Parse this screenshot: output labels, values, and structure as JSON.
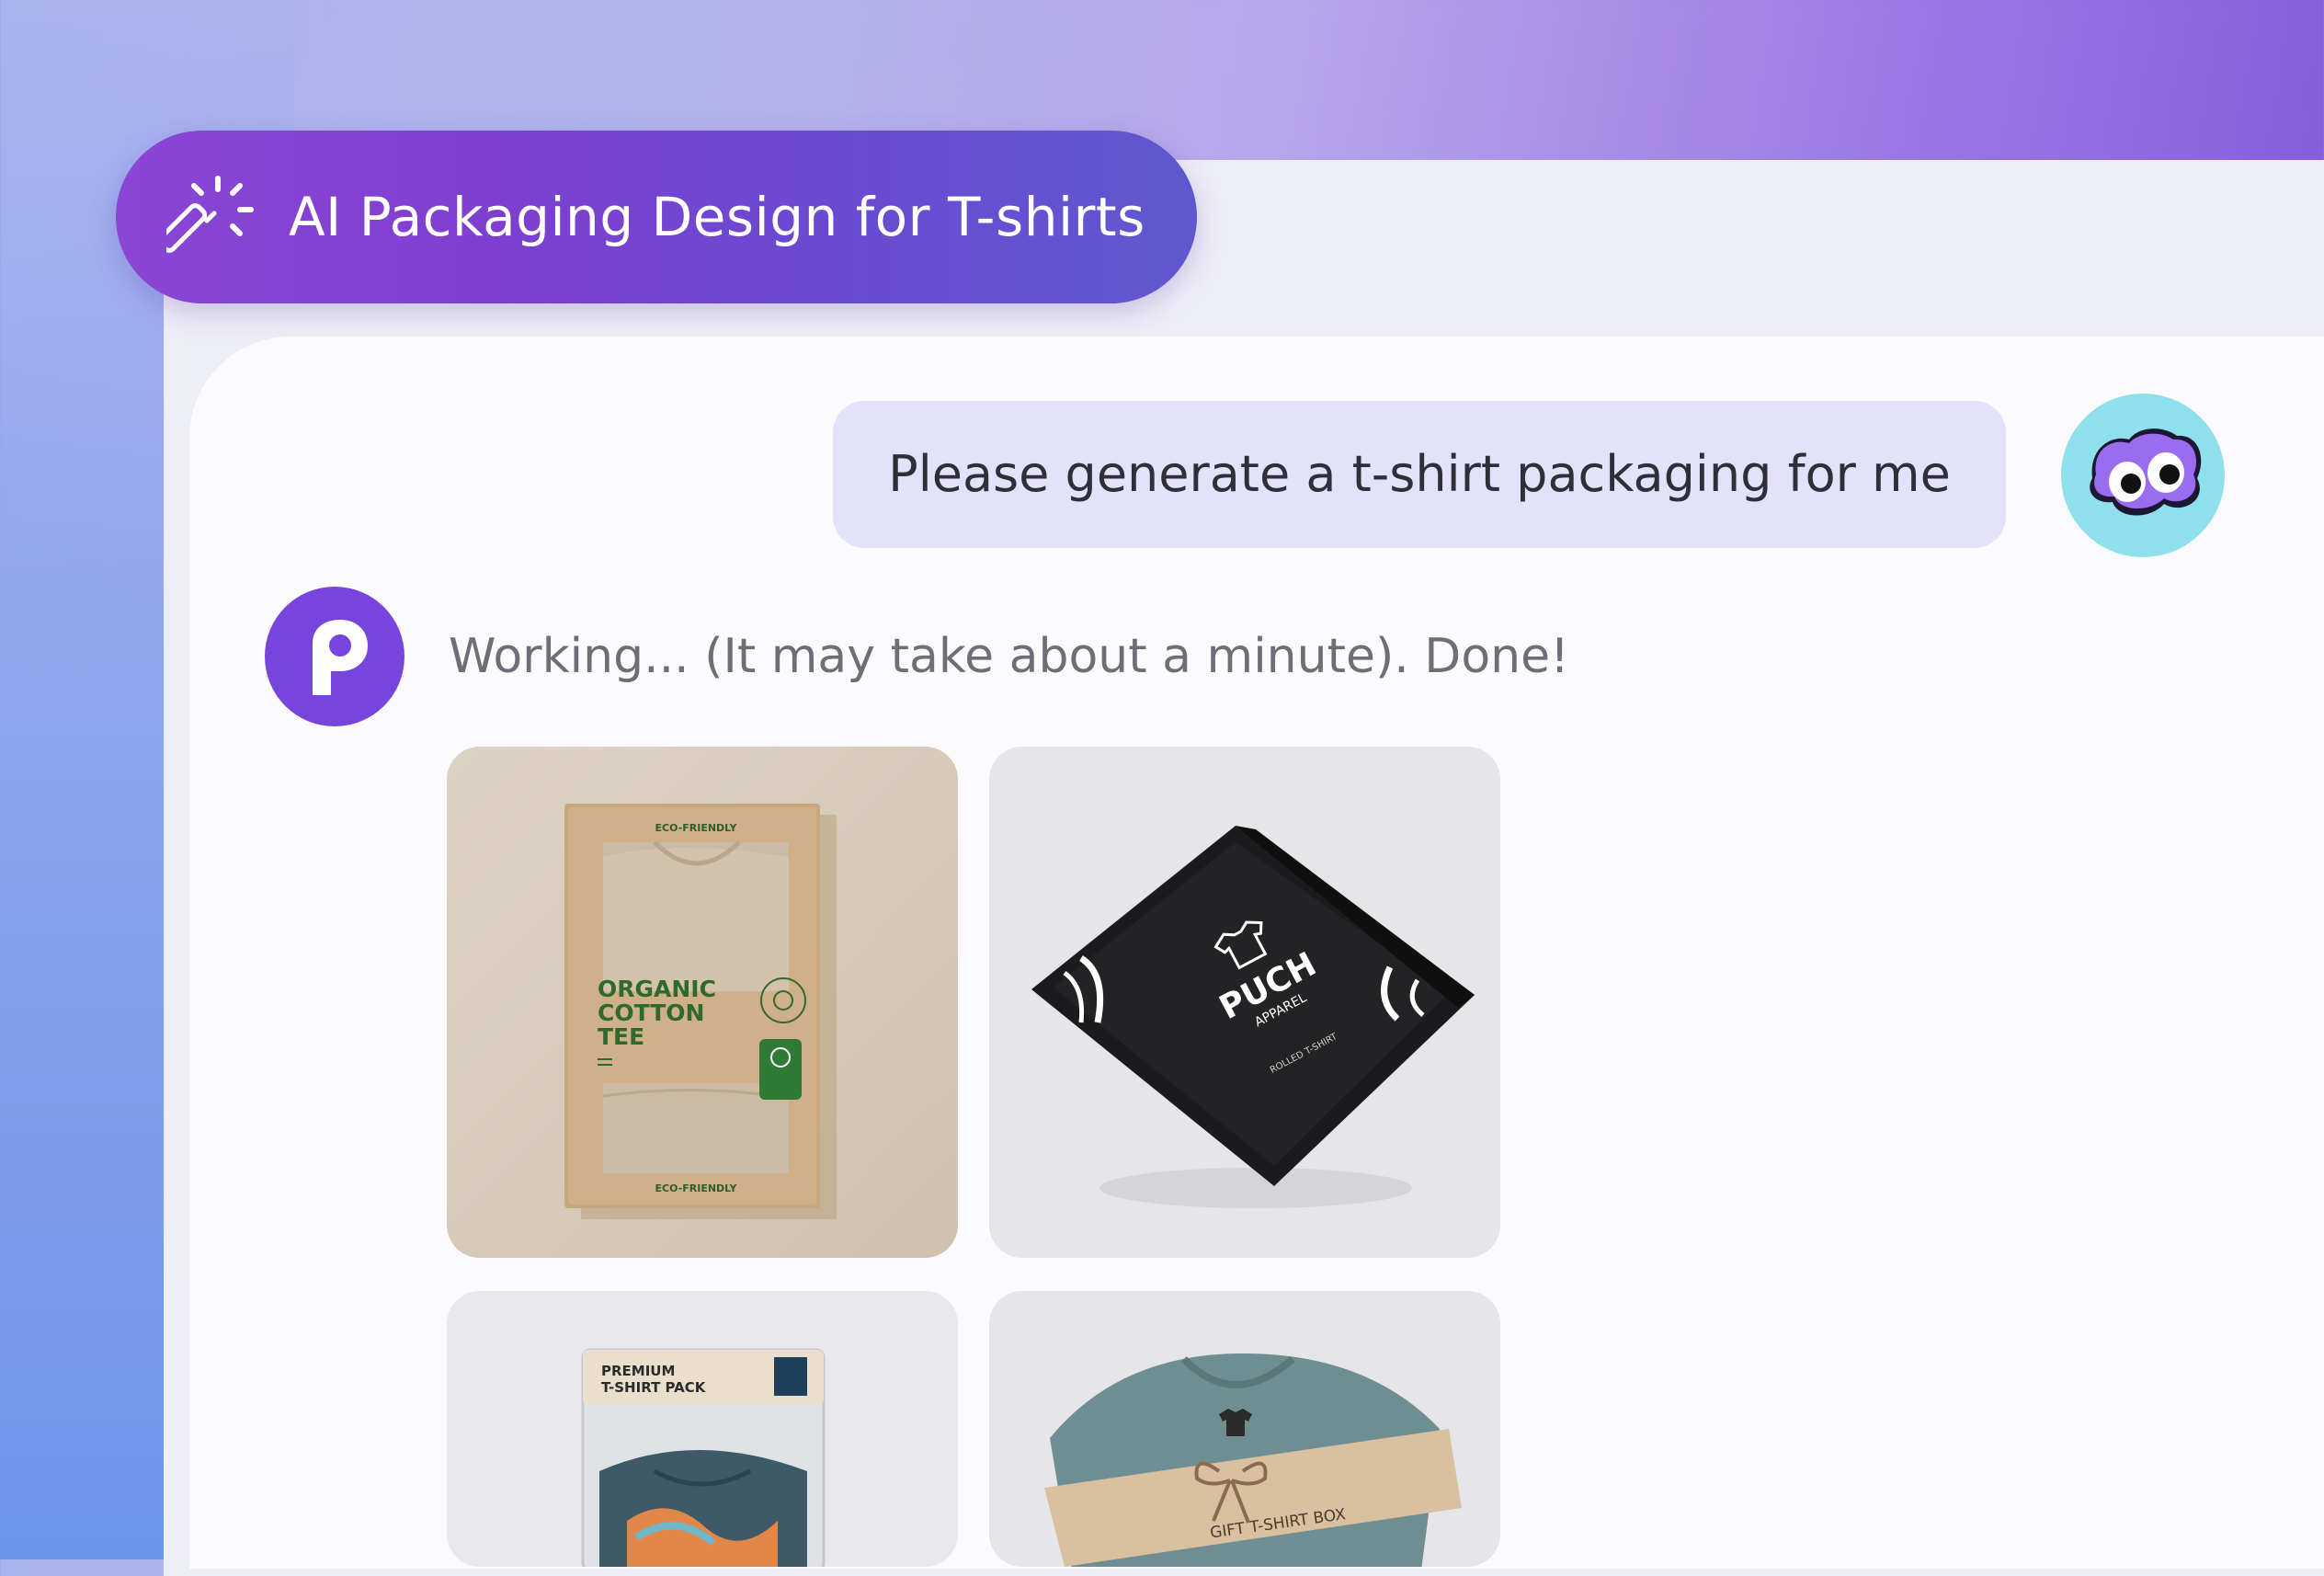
{
  "header": {
    "title": "AI Packaging Design for T-shirts",
    "icon": "magic-wand-icon"
  },
  "chat": {
    "user_message": "Please generate a t-shirt packaging for me",
    "bot_status": "Working... (It may take about a minute). Done!",
    "bot_avatar_letter": "P"
  },
  "images": [
    {
      "name": "kraft-box",
      "top_label": "ECO-FRIENDLY",
      "line1": "ORGANIC",
      "line2": "COTTON",
      "line3": "TEE",
      "bottom_label": "ECO-FRIENDLY"
    },
    {
      "name": "black-poly-mailer",
      "brand": "PUCH",
      "sub": "APPAREL",
      "small": "ROLLED T-SHIRT"
    },
    {
      "name": "clear-pouch",
      "label_line1": "PREMIUM",
      "label_line2": "T-SHIRT PACK"
    },
    {
      "name": "gift-wrap",
      "band_text": "GIFT T-SHIRT BOX"
    }
  ],
  "colors": {
    "accent": "#7845dc",
    "user_bubble": "#e4e2fb",
    "title_pill": "#7e3fd1"
  }
}
